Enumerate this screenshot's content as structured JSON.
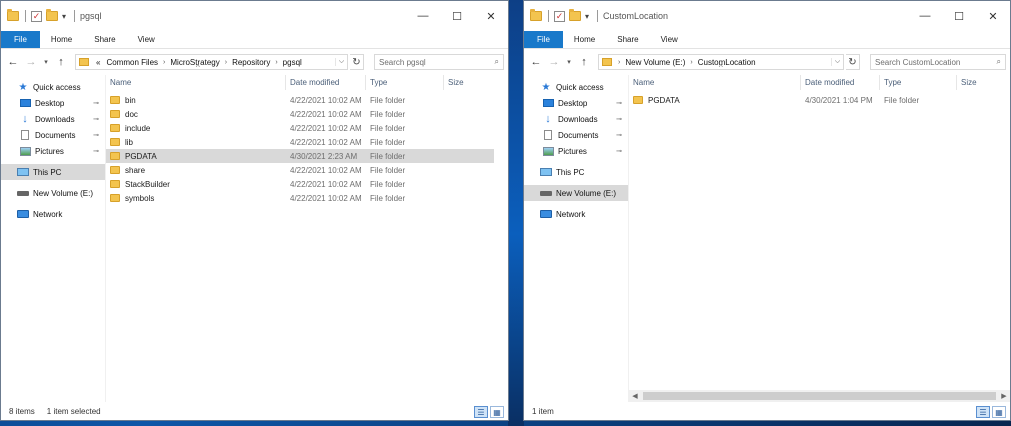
{
  "windows": {
    "left": {
      "title": "pgsql",
      "ribbon": [
        "File",
        "Home",
        "Share",
        "View"
      ],
      "breadcrumb": [
        "«",
        "Common Files",
        "MicroStrategy",
        "Repository",
        "pgsql"
      ],
      "search_placeholder": "Search pgsql",
      "nav": [
        {
          "label": "Quick access",
          "icon": "star-icon"
        },
        {
          "label": "Desktop",
          "icon": "desktop-icon",
          "pinned": true
        },
        {
          "label": "Downloads",
          "icon": "downloads-icon",
          "pinned": true
        },
        {
          "label": "Documents",
          "icon": "documents-icon",
          "pinned": true
        },
        {
          "label": "Pictures",
          "icon": "pictures-icon",
          "pinned": true
        },
        {
          "label": "This PC",
          "icon": "pc-icon"
        },
        {
          "label": "New Volume (E:)",
          "icon": "drive-icon"
        },
        {
          "label": "Network",
          "icon": "network-icon"
        }
      ],
      "columns": {
        "name": "Name",
        "date": "Date modified",
        "type": "Type",
        "size": "Size"
      },
      "files": [
        {
          "name": "bin",
          "date": "4/22/2021 10:02 AM",
          "type": "File folder"
        },
        {
          "name": "doc",
          "date": "4/22/2021 10:02 AM",
          "type": "File folder"
        },
        {
          "name": "include",
          "date": "4/22/2021 10:02 AM",
          "type": "File folder"
        },
        {
          "name": "lib",
          "date": "4/22/2021 10:02 AM",
          "type": "File folder"
        },
        {
          "name": "PGDATA",
          "date": "4/30/2021 2:23 AM",
          "type": "File folder"
        },
        {
          "name": "share",
          "date": "4/22/2021 10:02 AM",
          "type": "File folder"
        },
        {
          "name": "StackBuilder",
          "date": "4/22/2021 10:02 AM",
          "type": "File folder"
        },
        {
          "name": "symbols",
          "date": "4/22/2021 10:02 AM",
          "type": "File folder"
        }
      ],
      "status_count": "8 items",
      "status_selected": "1 item selected"
    },
    "right": {
      "title": "CustomLocation",
      "ribbon": [
        "File",
        "Home",
        "Share",
        "View"
      ],
      "breadcrumb": [
        "New Volume (E:)",
        "CustomLocation"
      ],
      "search_placeholder": "Search CustomLocation",
      "nav": [
        {
          "label": "Quick access",
          "icon": "star-icon"
        },
        {
          "label": "Desktop",
          "icon": "desktop-icon",
          "pinned": true
        },
        {
          "label": "Downloads",
          "icon": "downloads-icon",
          "pinned": true
        },
        {
          "label": "Documents",
          "icon": "documents-icon",
          "pinned": true
        },
        {
          "label": "Pictures",
          "icon": "pictures-icon",
          "pinned": true
        },
        {
          "label": "This PC",
          "icon": "pc-icon"
        },
        {
          "label": "New Volume (E:)",
          "icon": "drive-icon"
        },
        {
          "label": "Network",
          "icon": "network-icon"
        }
      ],
      "columns": {
        "name": "Name",
        "date": "Date modified",
        "type": "Type",
        "size": "Size"
      },
      "files": [
        {
          "name": "PGDATA",
          "date": "4/30/2021 1:04 PM",
          "type": "File folder"
        }
      ],
      "status_count": "1 item"
    }
  },
  "glyphs": {
    "minimize": "—",
    "maximize": "☐",
    "close": "✕",
    "back": "←",
    "forward": "→",
    "up": "↑",
    "dropdown": "⌵",
    "refresh": "↻",
    "search": "⌕",
    "pin": "📌",
    "chevron": "›"
  },
  "colors": {
    "file_tab": "#1979ca",
    "selection": "#d9d9d9",
    "folder": "#f3c44f"
  }
}
